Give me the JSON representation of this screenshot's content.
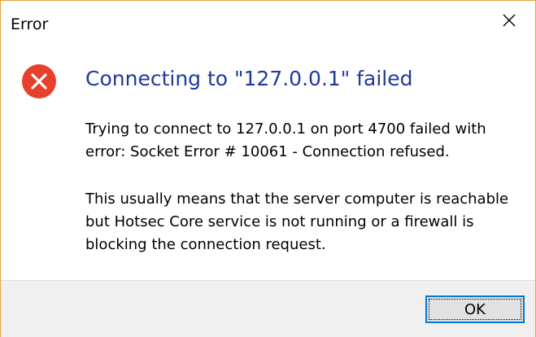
{
  "window": {
    "title": "Error",
    "close_icon": "close-icon"
  },
  "message": {
    "icon": "error-icon",
    "main_instruction": "Connecting to \"127.0.0.1\" failed",
    "paragraph1": "Trying to connect to 127.0.0.1 on port 4700 failed with\nerror: Socket Error # 10061 - Connection refused.",
    "paragraph2": "This usually means that the server computer is reachable\nbut Hotsec Core service is not running or a firewall is\nblocking the connection request."
  },
  "buttons": {
    "ok_label": "OK"
  },
  "colors": {
    "accent_border": "#e8a33c",
    "instruction_text": "#1f3a9c",
    "error_red": "#e8402c",
    "button_focus": "#0078d7"
  }
}
